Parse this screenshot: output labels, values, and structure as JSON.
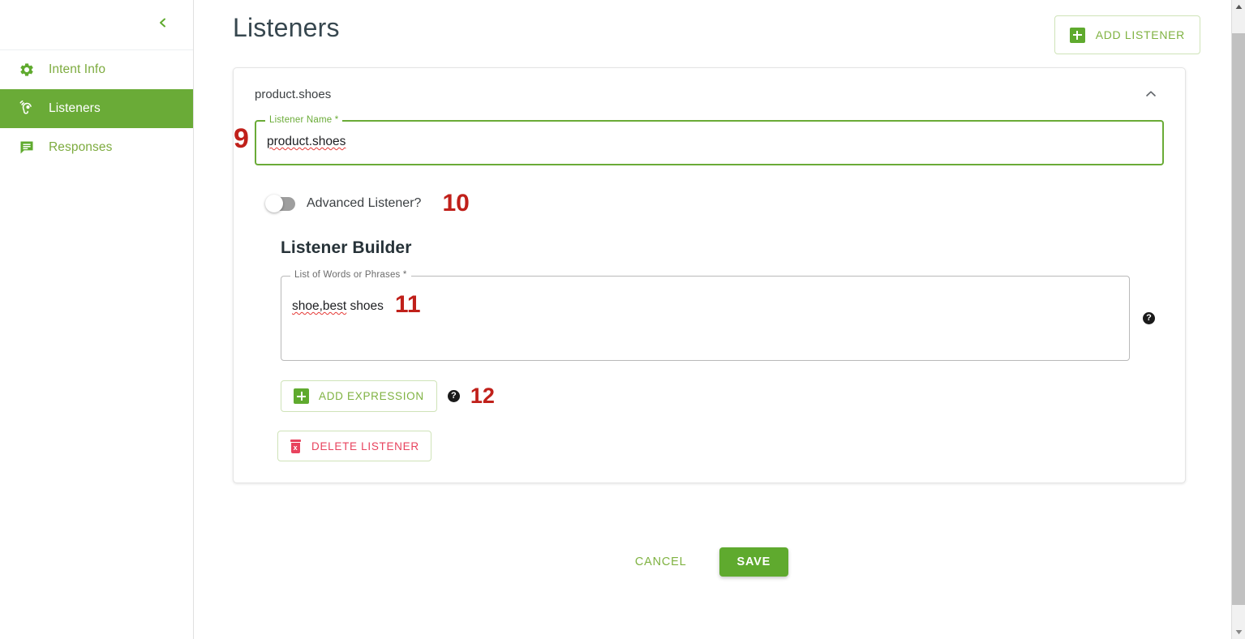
{
  "sidebar": {
    "collapse_icon": "chevron-left-icon",
    "items": [
      {
        "label": "Intent Info",
        "icon": "gear-icon",
        "active": false
      },
      {
        "label": "Listeners",
        "icon": "ear-listen-icon",
        "active": true
      },
      {
        "label": "Responses",
        "icon": "message-icon",
        "active": false
      }
    ]
  },
  "header": {
    "title": "Listeners",
    "add_listener_label": "ADD LISTENER",
    "add_listener_icon": "plus-square-icon"
  },
  "listener_card": {
    "header_title": "product.shoes",
    "collapse_icon": "chevron-up-icon",
    "name_field": {
      "label": "Listener Name *",
      "value": "product.shoes",
      "annotation": "9"
    },
    "advanced_toggle": {
      "label": "Advanced Listener?",
      "state": "off",
      "annotation": "10"
    },
    "builder": {
      "title": "Listener Builder",
      "words_field": {
        "label": "List of Words or Phrases *",
        "value_spell": "shoe,best",
        "value_rest": " shoes",
        "annotation": "11",
        "help_icon": "help-circle-icon"
      },
      "add_expression": {
        "label": "ADD EXPRESSION",
        "icon": "plus-square-icon",
        "help_icon": "help-circle-icon",
        "help_glyph": "?",
        "annotation": "12"
      }
    },
    "delete_listener": {
      "label": "DELETE LISTENER",
      "icon": "trash-icon"
    }
  },
  "footer": {
    "cancel_label": "CANCEL",
    "save_label": "SAVE"
  },
  "scrollbar": {
    "up_icon": "scroll-up-arrow-icon",
    "down_icon": "scroll-down-arrow-icon",
    "thumb": "scrollbar-thumb"
  },
  "colors": {
    "brand_green": "#6aab37",
    "accent_green": "#5faa2e",
    "link_green": "#7fb241",
    "danger_red": "#e8435e",
    "annotation_red": "#c0201a",
    "text_dark": "#37474f"
  }
}
